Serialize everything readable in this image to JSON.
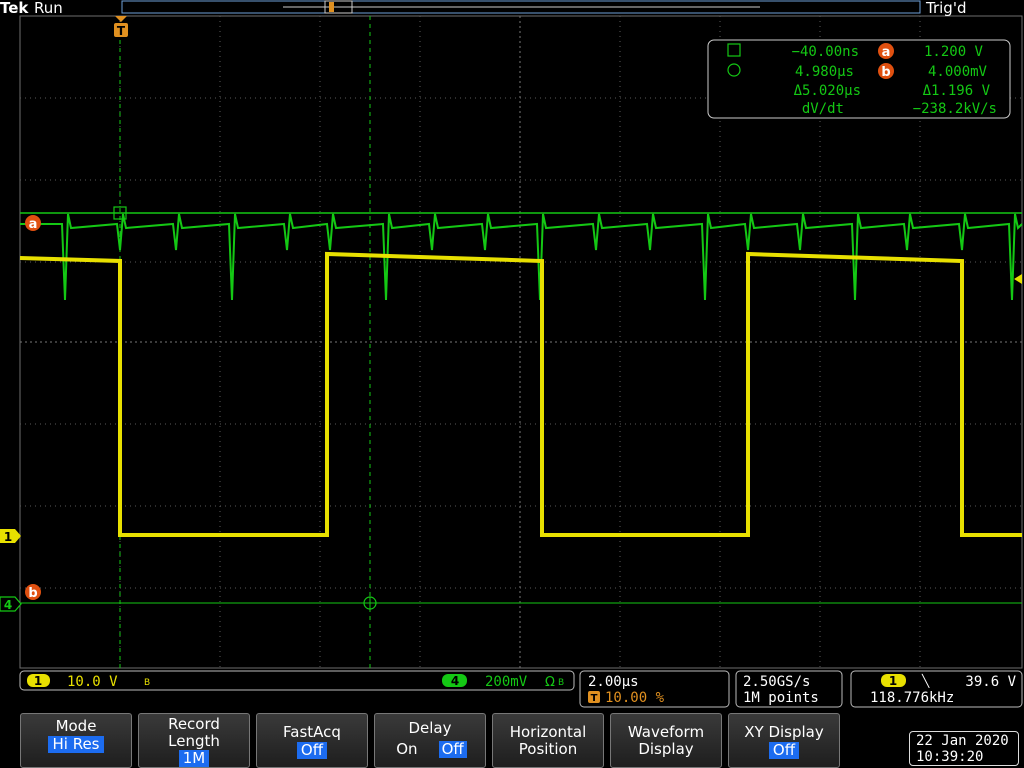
{
  "header": {
    "brand": "Tek",
    "state": "Run",
    "trigger_status": "Trig'd",
    "trigger_position_marker": "T"
  },
  "cursor_readout": {
    "cursor_a_time": "−40.00ns",
    "cursor_b_time": "4.980µs",
    "delta_time": "Δ5.020µs",
    "dvdt_label": "dV/dt",
    "cursor_a_label": "a",
    "cursor_a_volt": "1.200 V",
    "cursor_b_label": "b",
    "cursor_b_volt": "4.000mV",
    "delta_volt": "Δ1.196 V",
    "dvdt_value": "−238.2kV/s"
  },
  "markers": {
    "ch1": "1",
    "ch4": "4",
    "cursor_a": "a",
    "cursor_b": "b"
  },
  "channel_bar": {
    "ch1_num": "1",
    "ch1_scale": "10.0 V",
    "ch1_bw": "B",
    "ch4_num": "4",
    "ch4_scale": "200mV",
    "ch4_coupling": "Ω",
    "ch4_bw": "B"
  },
  "timebase": {
    "scale": "2.00µs",
    "trigger_marker": "T",
    "trigger_position": "10.00 %"
  },
  "acquisition": {
    "sample_rate": "2.50GS/s",
    "record": "1M points"
  },
  "trigger": {
    "source": "1",
    "slope_symbol": "╲",
    "level": "39.6 V",
    "frequency": "118.776kHz"
  },
  "softkeys": {
    "mode_label": "Mode",
    "mode_value": "Hi Res",
    "record_label": "Record",
    "record_label2": "Length",
    "record_value": "1M",
    "fastacq_label": "FastAcq",
    "fastacq_value": "Off",
    "delay_label": "Delay",
    "delay_on": "On",
    "delay_off": "Off",
    "hpos_label": "Horizontal",
    "hpos_label2": "Position",
    "wfm_label": "Waveform",
    "wfm_label2": "Display",
    "xy_label": "XY Display",
    "xy_value": "Off"
  },
  "datetime": {
    "date": "22 Jan  2020",
    "time": "10:39:20"
  },
  "colors": {
    "ch1": "#e8e000",
    "ch4": "#14c814",
    "cursor_badge": "#e05010",
    "grid": "#6e6e6e",
    "highlight": "#1c6cf0"
  }
}
